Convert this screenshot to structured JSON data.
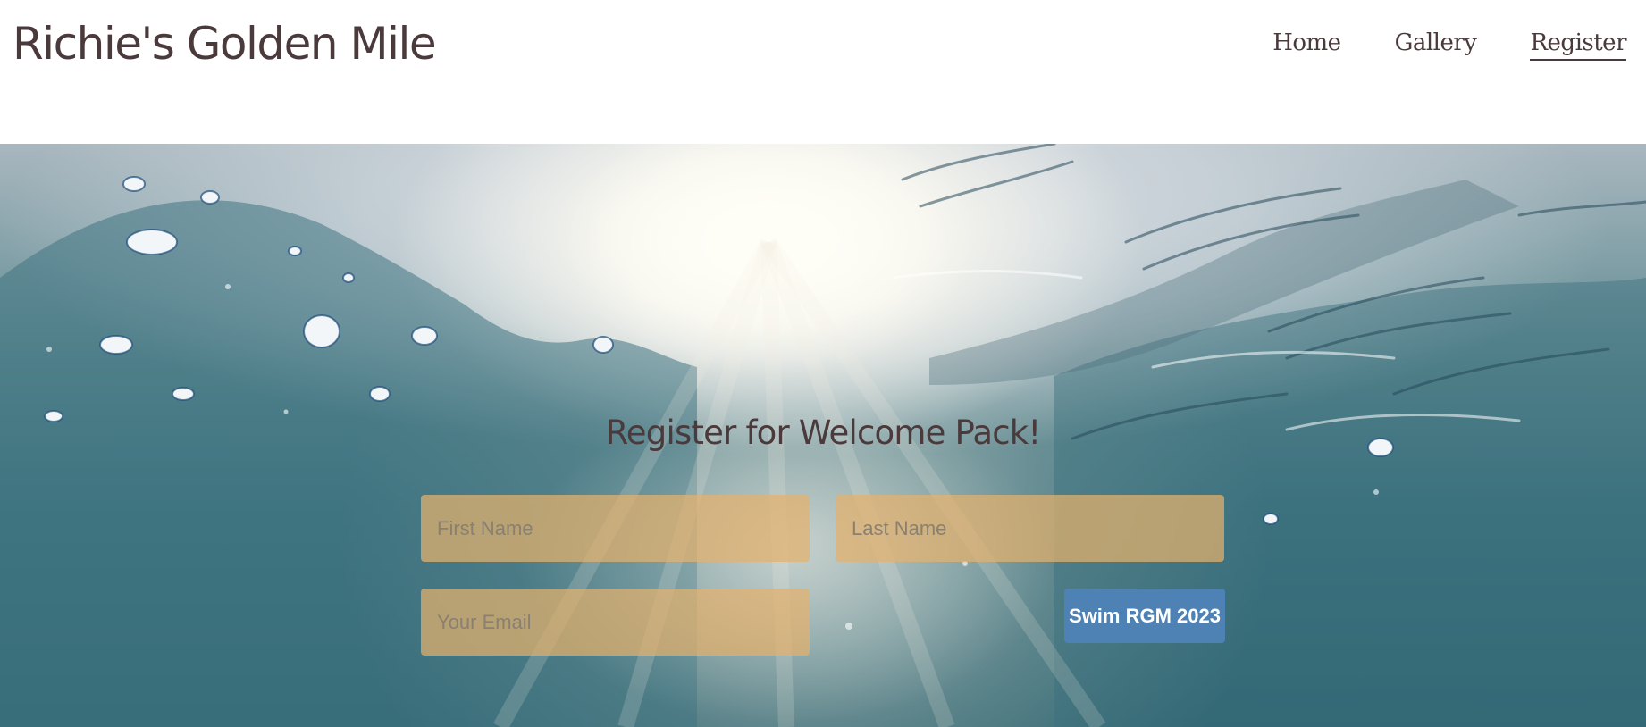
{
  "header": {
    "brand": "Richie's Golden Mile",
    "nav": [
      {
        "label": "Home",
        "active": false
      },
      {
        "label": "Gallery",
        "active": false
      },
      {
        "label": "Register",
        "active": true
      }
    ]
  },
  "hero": {
    "background": "underwater-sunlight-image"
  },
  "form": {
    "title": "Register for Welcome Pack!",
    "first_name_placeholder": "First Name",
    "last_name_placeholder": "Last Name",
    "email_placeholder": "Your Email",
    "submit_label": "Swim RGM 2023"
  },
  "colors": {
    "text": "#4a3a3b",
    "field_bg": "#e4b16c",
    "button_bg": "#4e82b4",
    "button_text": "#ffffff"
  }
}
